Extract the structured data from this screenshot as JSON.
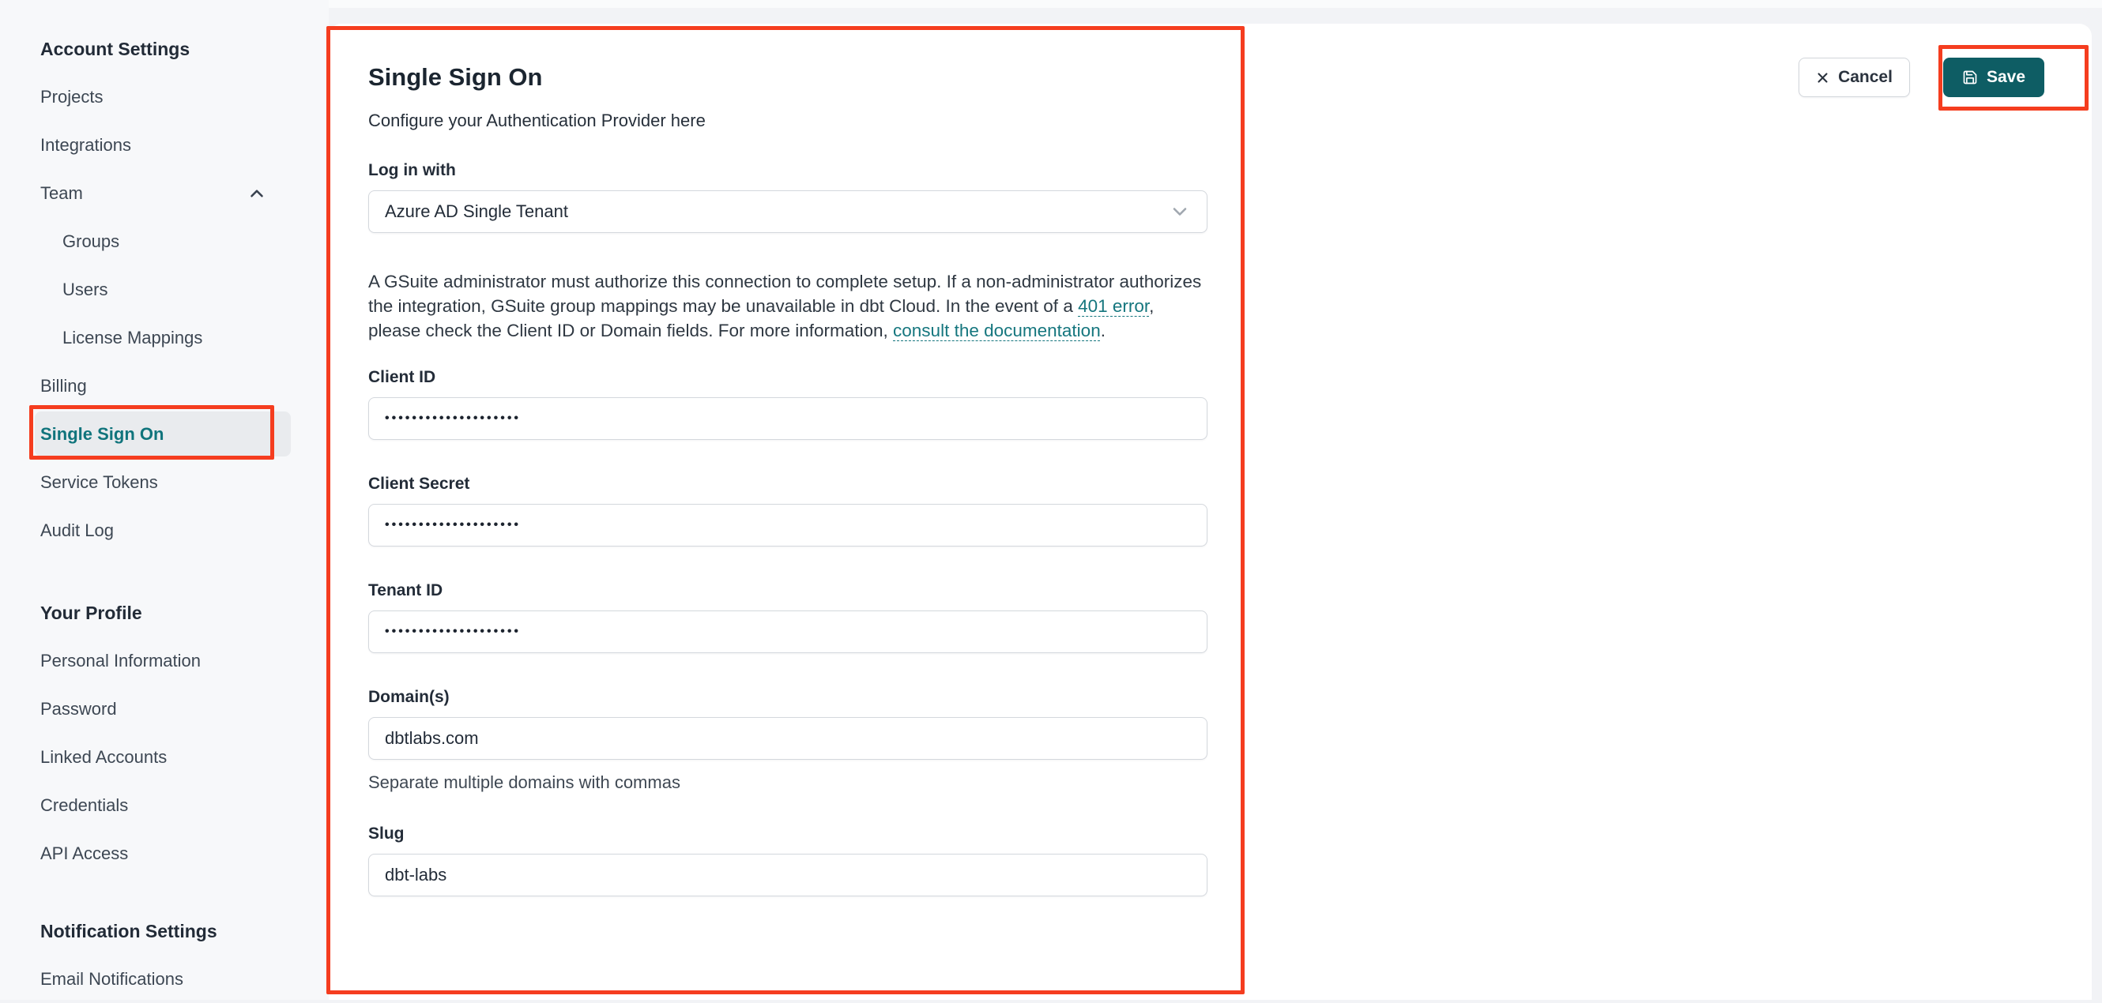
{
  "colors": {
    "accent_teal": "#0e5d64",
    "link_teal": "#15767e",
    "active_item_teal": "#10747c",
    "annotation_red": "#f53d1f"
  },
  "sidebar": {
    "sections": [
      {
        "heading": "Account Settings",
        "items": [
          {
            "label": "Projects"
          },
          {
            "label": "Integrations"
          },
          {
            "label": "Team"
          },
          {
            "label": "Groups"
          },
          {
            "label": "Users"
          },
          {
            "label": "License Mappings"
          },
          {
            "label": "Billing"
          },
          {
            "label": "Single Sign On"
          },
          {
            "label": "Service Tokens"
          },
          {
            "label": "Audit Log"
          }
        ]
      },
      {
        "heading": "Your Profile",
        "items": [
          {
            "label": "Personal Information"
          },
          {
            "label": "Password"
          },
          {
            "label": "Linked Accounts"
          },
          {
            "label": "Credentials"
          },
          {
            "label": "API Access"
          }
        ]
      },
      {
        "heading": "Notification Settings",
        "items": [
          {
            "label": "Email Notifications"
          }
        ]
      }
    ]
  },
  "main": {
    "title": "Single Sign On",
    "subtitle": "Configure your Authentication Provider here",
    "login_with": {
      "label": "Log in with",
      "value": "Azure AD Single Tenant"
    },
    "note": {
      "part1": "A GSuite administrator must authorize this connection to complete setup. If a non-administrator authorizes the integration, GSuite group mappings may be unavailable in dbt Cloud. In the event of a ",
      "link1": "401 error",
      "part2": ", please check the Client ID or Domain fields. For more information, ",
      "link2": "consult the documentation",
      "part3": "."
    },
    "fields": {
      "client_id": {
        "label": "Client ID",
        "value": "••••••••••••••••••••"
      },
      "client_secret": {
        "label": "Client Secret",
        "value": "••••••••••••••••••••"
      },
      "tenant_id": {
        "label": "Tenant ID",
        "value": "••••••••••••••••••••"
      },
      "domains": {
        "label": "Domain(s)",
        "value": "dbtlabs.com",
        "helper": "Separate multiple domains with commas"
      },
      "slug": {
        "label": "Slug",
        "value": "dbt-labs"
      }
    }
  },
  "actions": {
    "cancel": "Cancel",
    "save": "Save"
  }
}
